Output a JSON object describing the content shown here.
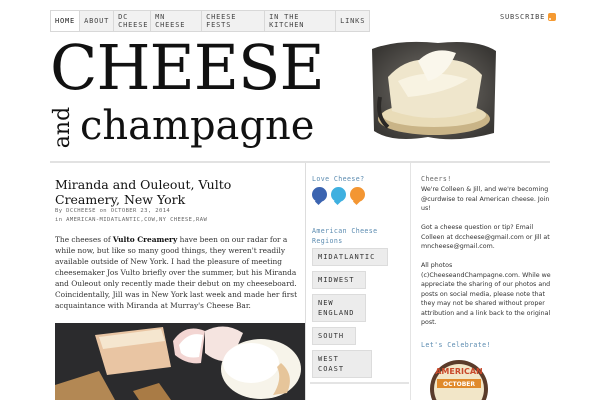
{
  "nav": {
    "items": [
      "HOME",
      "ABOUT",
      "DC CHEESE",
      "MN CHEESE",
      "CHEESE FESTS",
      "IN THE KITCHEN",
      "LINKS"
    ],
    "subscribe": "SUBSCRIBE"
  },
  "header": {
    "title_big": "CHEESE",
    "title_and": "and",
    "title_small": "champagne"
  },
  "post": {
    "title": "Miranda and Ouleout, Vulto Creamery, New York",
    "meta_by": "By",
    "meta_author": "DCCHEESE",
    "meta_on": "on",
    "meta_date": "OCTOBER 23, 2014",
    "meta_in": "in",
    "meta_categories": "AMERICAN-MIDATLANTIC,COW,NY CHEESE,RAW",
    "body_before": "The cheeses of ",
    "body_bold": "Vulto Creamery",
    "body_after": " have been on our radar for a while now, but like so many good things, they weren't readily available outside of New York. I had the pleasure of meeting cheesemaker Jos Vulto briefly over the summer, but his Miranda and Ouleout only recently made their debut on my cheeseboard. Coincidentally, Jill was in New York last week and made her first acquaintance with Miranda at Murray's Cheese Bar."
  },
  "sidebar_mid": {
    "love_heading": "Love Cheese?",
    "icons": [
      "facebook-icon",
      "twitter-icon",
      "rss-icon"
    ],
    "regions_heading": "American Cheese Regions",
    "regions": [
      "MIDATLANTIC",
      "MIDWEST",
      "NEW ENGLAND",
      "SOUTH",
      "WEST COAST"
    ]
  },
  "sidebar_right": {
    "heading": "Cheers!",
    "p1": "We're Colleen & Jill, and we're becoming @curdwise to real American cheese. Join us!",
    "p2": "Got a cheese question or tip? Email Colleen at dccheese@gmail.com or Jill at mncheese@gmail.com.",
    "p3": "All photos (c)CheeseandChampagne.com. While we appreciate the sharing of our photos and posts on social media, please note that they may not be shared without proper attribution and a link back to the original post.",
    "celebrate_heading": "Let's Celebrate!",
    "badge_top": "AMERICAN",
    "badge_mid": "OCTOBER"
  },
  "colors": {
    "accent_blue": "#5b8bb0",
    "rss_orange": "#f59a32",
    "facebook_blue": "#3b64b0",
    "twitter_blue": "#3fb0e0"
  }
}
